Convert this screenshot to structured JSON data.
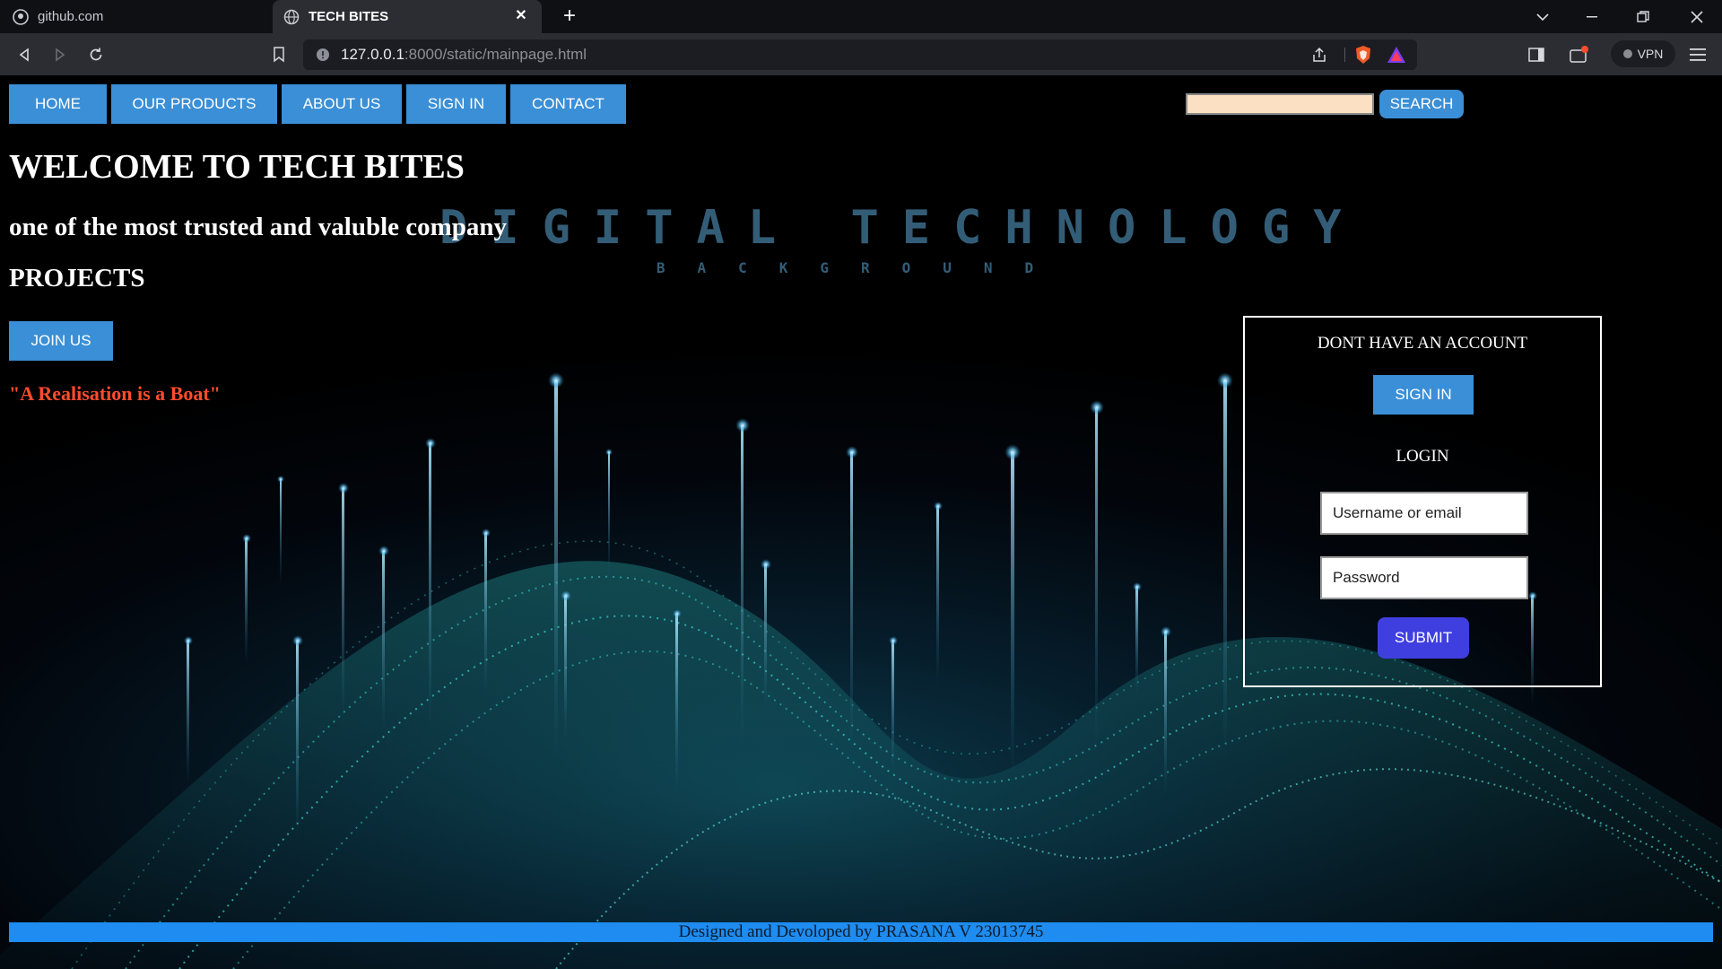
{
  "browser": {
    "tabs": [
      {
        "title": "github.com",
        "icon": "github-icon"
      },
      {
        "title": "TECH BITES",
        "icon": "globe-icon"
      }
    ],
    "url_host": "127.0.0.1",
    "url_rest": ":8000/static/mainpage.html",
    "vpn_label": "VPN"
  },
  "nav": {
    "items": [
      "HOME",
      "OUR PRODUCTS",
      "ABOUT US",
      "SIGN IN",
      "CONTACT"
    ]
  },
  "search": {
    "value": "",
    "button_label": "SEARCH"
  },
  "hero": {
    "title": "WELCOME TO TECH BITES",
    "subtitle": "one of the most trusted and valuble company",
    "projects": "PROJECTS",
    "join_label": "JOIN US",
    "quote": "\"A Realisation is a Boat\""
  },
  "background": {
    "title": "DIGITAL TECHNOLOGY",
    "subtitle": "BACKGROUND"
  },
  "login_box": {
    "no_account_heading": "DONT HAVE AN ACCOUNT",
    "signin_label": "SIGN IN",
    "login_heading": "LOGIN",
    "username_placeholder": "Username or email",
    "password_placeholder": "Password",
    "submit_label": "SUBMIT"
  },
  "footer": {
    "text": "Designed and Devoloped by PRASANA V 23013745"
  },
  "colors": {
    "accent": "#3a8fd6",
    "submit": "#3f3fe0",
    "quote": "#ff4d2e",
    "footer": "#1e8cf0",
    "search_field": "#fbe0c3"
  }
}
